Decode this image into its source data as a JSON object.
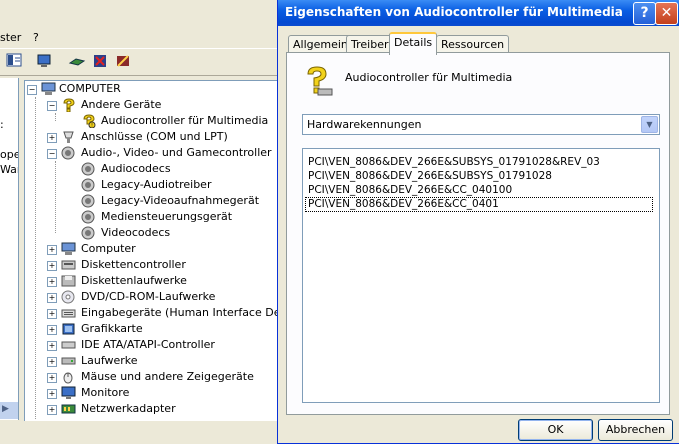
{
  "background_window": {
    "menu": [
      "ster",
      "?"
    ],
    "left_pane_fragments": [
      ":",
      "ope",
      "War"
    ],
    "tree": {
      "root": "COMPUTER",
      "items": [
        {
          "label": "Andere Geräte",
          "icon": "question-icon",
          "expanded": true,
          "level": 1
        },
        {
          "label": "Audiocontroller für Multimedia",
          "icon": "question-warning-icon",
          "level": 2
        },
        {
          "label": "Anschlüsse (COM und LPT)",
          "icon": "port-icon",
          "expanded": false,
          "level": 1
        },
        {
          "label": "Audio-, Video- und Gamecontroller",
          "icon": "speaker-icon",
          "expanded": true,
          "level": 1
        },
        {
          "label": "Audiocodecs",
          "icon": "speaker-icon",
          "level": 2
        },
        {
          "label": "Legacy-Audiotreiber",
          "icon": "speaker-icon",
          "level": 2
        },
        {
          "label": "Legacy-Videoaufnahmegerät",
          "icon": "speaker-icon",
          "level": 2
        },
        {
          "label": "Mediensteuerungsgerät",
          "icon": "speaker-icon",
          "level": 2
        },
        {
          "label": "Videocodecs",
          "icon": "speaker-icon",
          "level": 2
        },
        {
          "label": "Computer",
          "icon": "computer-icon",
          "expanded": false,
          "level": 1
        },
        {
          "label": "Diskettencontroller",
          "icon": "floppy-controller-icon",
          "expanded": false,
          "level": 1
        },
        {
          "label": "Diskettenlaufwerke",
          "icon": "floppy-icon",
          "expanded": false,
          "level": 1
        },
        {
          "label": "DVD/CD-ROM-Laufwerke",
          "icon": "cdrom-icon",
          "expanded": false,
          "level": 1
        },
        {
          "label": "Eingabegeräte (Human Interface Devices)",
          "icon": "keyboard-icon",
          "expanded": false,
          "level": 1
        },
        {
          "label": "Grafikkarte",
          "icon": "display-adapter-icon",
          "expanded": false,
          "level": 1
        },
        {
          "label": "IDE ATA/ATAPI-Controller",
          "icon": "ide-icon",
          "expanded": false,
          "level": 1
        },
        {
          "label": "Laufwerke",
          "icon": "disk-icon",
          "expanded": false,
          "level": 1
        },
        {
          "label": "Mäuse und andere Zeigegeräte",
          "icon": "mouse-icon",
          "expanded": false,
          "level": 1
        },
        {
          "label": "Monitore",
          "icon": "monitor-icon",
          "expanded": false,
          "level": 1
        },
        {
          "label": "Netzwerkadapter",
          "icon": "network-icon",
          "expanded": false,
          "level": 1
        }
      ]
    }
  },
  "dialog": {
    "title": "Eigenschaften von Audiocontroller für Multimedia",
    "help_glyph": "?",
    "close_glyph": "✕",
    "tabs": [
      {
        "label": "Allgemein",
        "active": false
      },
      {
        "label": "Treiber",
        "active": false
      },
      {
        "label": "Details",
        "active": true
      },
      {
        "label": "Ressourcen",
        "active": false
      }
    ],
    "device_name": "Audiocontroller für Multimedia",
    "property_select": {
      "value": "Hardwarekennungen"
    },
    "values": [
      "PCI\\VEN_8086&DEV_266E&SUBSYS_01791028&REV_03",
      "PCI\\VEN_8086&DEV_266E&SUBSYS_01791028",
      "PCI\\VEN_8086&DEV_266E&CC_040100",
      "PCI\\VEN_8086&DEV_266E&CC_0401"
    ],
    "ok_label": "OK",
    "cancel_label": "Abbrechen"
  },
  "colors": {
    "titlebar": "#0a5ee3",
    "close_button": "#c3401c",
    "active_tab_highlight": "#ffc83c",
    "window_face": "#ece9d8"
  }
}
